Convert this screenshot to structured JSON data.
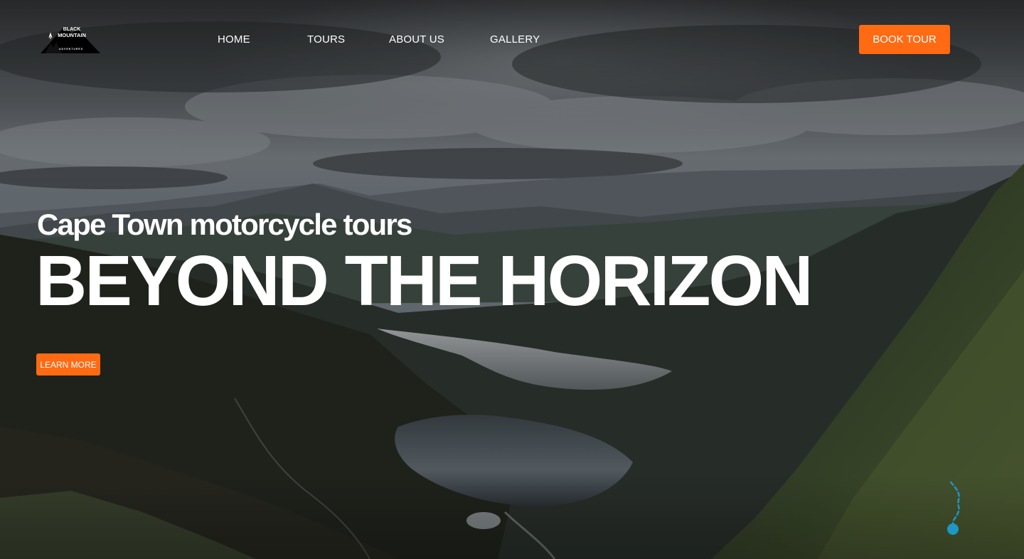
{
  "brand": {
    "logo_line1": "BLACK",
    "logo_line2": "MOUNTAIN",
    "logo_line3": "ADVENTURES",
    "accent_color": "#ff6a13"
  },
  "nav": {
    "items": [
      {
        "label": "HOME"
      },
      {
        "label": "TOURS"
      },
      {
        "label": "ABOUT US"
      },
      {
        "label": "GALLERY"
      }
    ],
    "cta_label": "BOOK TOUR"
  },
  "hero": {
    "subtitle": "Cape Town motorcycle tours",
    "headline": "BEYOND THE HORIZON",
    "button_label": "LEARN MORE",
    "background_image": "mountain-valley-lakes",
    "route_marker_icon": "route-marker-icon"
  }
}
